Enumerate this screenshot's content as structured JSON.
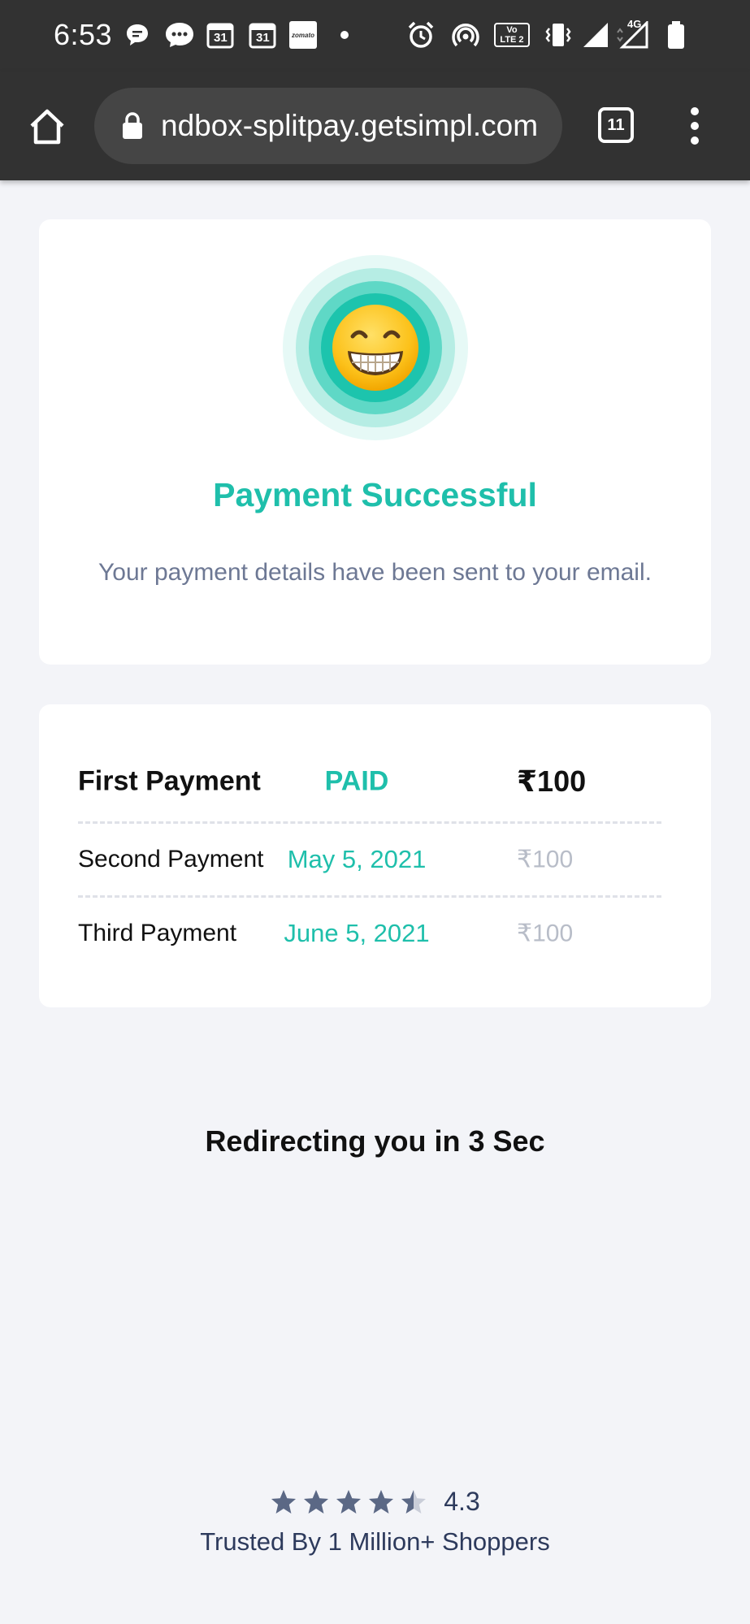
{
  "status_bar": {
    "time": "6:53",
    "calendar_day_1": "31",
    "calendar_day_2": "31",
    "zomato_label": "zomato",
    "volte_line1": "Vo",
    "volte_line2": "LTE 2",
    "network_label": "4G"
  },
  "browser": {
    "url": "ndbox-splitpay.getsimpl.com",
    "tab_count": "11"
  },
  "success": {
    "title": "Payment Successful",
    "subtitle": "Your payment details have been sent to your email."
  },
  "payments": [
    {
      "label": "First Payment",
      "status": "PAID",
      "amount": "₹100"
    },
    {
      "label": "Second Payment",
      "status": "May 5, 2021",
      "amount": "₹100"
    },
    {
      "label": "Third Payment",
      "status": "June 5, 2021",
      "amount": "₹100"
    }
  ],
  "redirect_text": "Redirecting you in 3 Sec",
  "footer": {
    "rating_value": "4.3",
    "rating_fraction": 0.86,
    "trusted_text": "Trusted By 1 Million+ Shoppers"
  },
  "colors": {
    "accent": "#1fbfab",
    "toolbar": "#323232",
    "background": "#f3f4f8",
    "muted_amount": "#b8bdc8",
    "footer_text": "#2d3a5c"
  },
  "icons": [
    "home-icon",
    "lock-icon",
    "grinning-face-emoji-icon",
    "star-icon",
    "half-star-icon",
    "alarm-icon",
    "signal-icon",
    "battery-icon"
  ]
}
